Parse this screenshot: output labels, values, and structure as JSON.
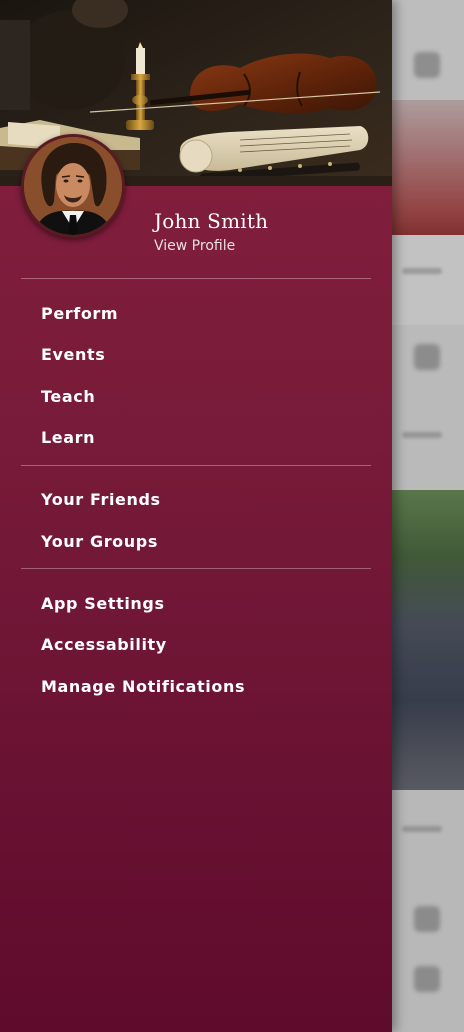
{
  "profile": {
    "name": "John Smith",
    "view_profile": "View Profile"
  },
  "menu": {
    "primary": [
      "Perform",
      "Events",
      "Teach",
      "Learn"
    ],
    "social": [
      "Your Friends",
      "Your Groups"
    ],
    "settings": [
      "App Settings",
      "Accessability",
      "Manage Notifications"
    ]
  },
  "colors": {
    "drawer_top": "#86203f",
    "drawer_bottom": "#5f0b2c",
    "text": "#ffffff"
  }
}
